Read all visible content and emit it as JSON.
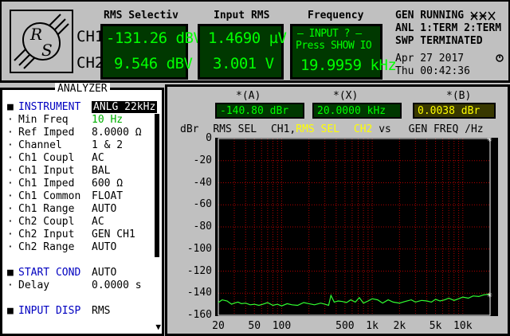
{
  "header": {
    "columns": {
      "rms_selective": "RMS Selectiv",
      "input_rms": "Input RMS",
      "frequency": "Frequency"
    },
    "channels": {
      "ch1": {
        "label": "CH1",
        "rms_selective": "-131.26 dBV",
        "input_rms": "1.4690 µV"
      },
      "ch2": {
        "label": "CH2",
        "rms_selective": "9.546 dBV",
        "input_rms": "3.001  V"
      }
    },
    "frequency_box": {
      "warning": "– INPUT ? –",
      "hint": "Press SHOW IO",
      "value": "19.9959 kHz"
    },
    "status": {
      "line1": "GEN RUNNING",
      "line2": "ANL 1:TERM 2:TERM",
      "line3": "SWP TERMINATED",
      "date": "Apr 27 2017",
      "time": "Thu  00:42:36"
    }
  },
  "analyzer": {
    "title": "ANALYZER",
    "rows": [
      {
        "mark": "■",
        "label": "INSTRUMENT",
        "value": "ANLG  22kHz",
        "section": true,
        "style": "sel"
      },
      {
        "mark": "·",
        "label": "Min Freq",
        "value": "10 Hz",
        "style": "green"
      },
      {
        "mark": "·",
        "label": "Ref Imped",
        "value": "8.0000 Ω"
      },
      {
        "mark": "·",
        "label": "Channel",
        "value": "1 & 2"
      },
      {
        "mark": "·",
        "label": "Ch1 Coupl",
        "value": "AC"
      },
      {
        "mark": "·",
        "label": "Ch1 Input",
        "value": "BAL"
      },
      {
        "mark": "·",
        "label": "Ch1 Imped",
        "value": "600 Ω"
      },
      {
        "mark": "·",
        "label": "Ch1 Common",
        "value": "FLOAT"
      },
      {
        "mark": "·",
        "label": "Ch1 Range",
        "value": "AUTO"
      },
      {
        "mark": "·",
        "label": "Ch2 Coupl",
        "value": "AC"
      },
      {
        "mark": "·",
        "label": "Ch2 Input",
        "value": "GEN CH1"
      },
      {
        "mark": "·",
        "label": "Ch2 Range",
        "value": "AUTO"
      },
      {
        "mark": "■",
        "label": "START COND",
        "value": "AUTO",
        "section": true
      },
      {
        "mark": "·",
        "label": "Delay",
        "value": "0.0000 s"
      },
      {
        "mark": "■",
        "label": "INPUT DISP",
        "value": "RMS",
        "section": true
      }
    ],
    "scroll_down": "▼"
  },
  "graph": {
    "cursor_a": {
      "label": "*(A)",
      "value": "-140.80 dBr"
    },
    "cursor_x": {
      "label": "*(X)",
      "value": "20.0000 kHz"
    },
    "cursor_b": {
      "label": "*(B)",
      "value": "0.0038 dBr"
    },
    "legend": {
      "unit": "dBr",
      "meas": "RMS SEL",
      "ch1": "CH1,",
      "rms_sel_y": "RMS SEL",
      "ch2": "CH2",
      "vs": "vs",
      "x_desc": "GEN FREQ /Hz"
    },
    "colors": {
      "trace": "#30ff30",
      "grid": "#b00000",
      "bg": "#000000"
    }
  },
  "chart_data": {
    "type": "line",
    "ylim": [
      -160,
      0
    ],
    "xlim": [
      20,
      20000
    ],
    "xscale": "log",
    "yticks": [
      "0",
      "-20",
      "-40",
      "-60",
      "-80",
      "-100",
      "-120",
      "-140",
      "-160"
    ],
    "xticks": [
      "20",
      "50",
      "100",
      "500",
      "1k",
      "2k",
      "5k",
      "10k"
    ],
    "xtick_values": [
      20,
      50,
      100,
      500,
      1000,
      2000,
      5000,
      10000
    ],
    "grid": true,
    "series": [
      {
        "x": [
          20,
          22,
          25,
          28,
          30,
          33,
          36,
          40,
          45,
          50,
          56,
          62,
          70,
          80,
          90,
          100,
          115,
          130,
          150,
          175,
          200,
          230,
          270,
          300,
          330,
          350,
          380,
          420,
          470,
          520,
          580,
          650,
          720,
          800,
          900,
          1000,
          1150,
          1300,
          1500,
          1700,
          2000,
          2300,
          2700,
          3000,
          3500,
          4000,
          4500,
          5000,
          5600,
          6300,
          7000,
          8000,
          9000,
          10000,
          11500,
          13000,
          15000,
          17000,
          20000
        ],
        "y": [
          -148.5,
          -146,
          -147,
          -150,
          -149,
          -148,
          -149.5,
          -149,
          -150.5,
          -150,
          -151,
          -150,
          -148.5,
          -151,
          -150,
          -151.5,
          -149.5,
          -150.5,
          -151,
          -148.5,
          -149.5,
          -150.5,
          -149,
          -150,
          -151,
          -142,
          -148,
          -147,
          -147.5,
          -148.5,
          -146,
          -148,
          -144,
          -149,
          -147,
          -145,
          -146,
          -149,
          -146,
          -148,
          -149,
          -147.5,
          -146,
          -148,
          -146.5,
          -147,
          -148,
          -145.5,
          -147,
          -146,
          -144.5,
          -146.5,
          -145,
          -143.5,
          -144.5,
          -142.5,
          -143,
          -141.5,
          -140.8
        ]
      }
    ]
  }
}
